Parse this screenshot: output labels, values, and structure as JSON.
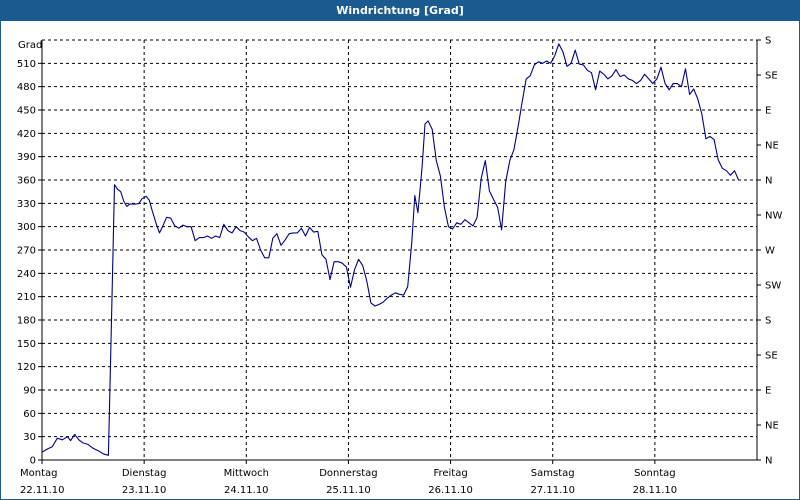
{
  "window": {
    "title": "Windrichtung [Grad]"
  },
  "chart_data": {
    "type": "line",
    "title": "Windrichtung [Grad]",
    "ylabel": "Grad",
    "ylim": [
      0,
      540
    ],
    "yticks": [
      0,
      30,
      60,
      90,
      120,
      150,
      180,
      210,
      240,
      270,
      300,
      330,
      360,
      390,
      420,
      450,
      480,
      510
    ],
    "ytick_labels_right": [
      "N",
      "NE",
      "E",
      "SE",
      "S",
      "SW",
      "W",
      "NW",
      "N",
      "NE",
      "E",
      "SE",
      "S"
    ],
    "xlim": [
      0,
      7
    ],
    "x_unit": "days",
    "x_ticks": [
      {
        "x": 0,
        "day": "Montag",
        "date": "22.11.10"
      },
      {
        "x": 1,
        "day": "Dienstag",
        "date": "23.11.10"
      },
      {
        "x": 2,
        "day": "Mittwoch",
        "date": "24.11.10"
      },
      {
        "x": 3,
        "day": "Donnerstag",
        "date": "25.11.10"
      },
      {
        "x": 4,
        "day": "Freitag",
        "date": "26.11.10"
      },
      {
        "x": 5,
        "day": "Samstag",
        "date": "27.11.10"
      },
      {
        "x": 6,
        "day": "Sonntag",
        "date": "28.11.10"
      }
    ],
    "grid": true,
    "line_color": "#00008b",
    "series": [
      {
        "points": [
          [
            0.0,
            10
          ],
          [
            0.05,
            14
          ],
          [
            0.1,
            17
          ],
          [
            0.15,
            28
          ],
          [
            0.2,
            26
          ],
          [
            0.25,
            30
          ],
          [
            0.28,
            25
          ],
          [
            0.32,
            33
          ],
          [
            0.36,
            26
          ],
          [
            0.4,
            22
          ],
          [
            0.45,
            20
          ],
          [
            0.5,
            15
          ],
          [
            0.55,
            12
          ],
          [
            0.6,
            8
          ],
          [
            0.65,
            6
          ],
          [
            0.68,
            180
          ],
          [
            0.71,
            354
          ],
          [
            0.74,
            348
          ],
          [
            0.77,
            345
          ],
          [
            0.8,
            333
          ],
          [
            0.83,
            326
          ],
          [
            0.86,
            329
          ],
          [
            0.89,
            329
          ],
          [
            0.92,
            329
          ],
          [
            0.95,
            330
          ],
          [
            0.98,
            336
          ],
          [
            1.02,
            339
          ],
          [
            1.05,
            334
          ],
          [
            1.08,
            320
          ],
          [
            1.12,
            303
          ],
          [
            1.15,
            292
          ],
          [
            1.18,
            300
          ],
          [
            1.22,
            312
          ],
          [
            1.26,
            311
          ],
          [
            1.3,
            301
          ],
          [
            1.34,
            298
          ],
          [
            1.38,
            302
          ],
          [
            1.42,
            300
          ],
          [
            1.46,
            300
          ],
          [
            1.5,
            282
          ],
          [
            1.54,
            286
          ],
          [
            1.58,
            286
          ],
          [
            1.62,
            288
          ],
          [
            1.66,
            285
          ],
          [
            1.7,
            288
          ],
          [
            1.74,
            286
          ],
          [
            1.78,
            303
          ],
          [
            1.82,
            295
          ],
          [
            1.86,
            292
          ],
          [
            1.9,
            300
          ],
          [
            1.94,
            295
          ],
          [
            1.98,
            293
          ],
          [
            2.02,
            287
          ],
          [
            2.06,
            282
          ],
          [
            2.1,
            285
          ],
          [
            2.14,
            270
          ],
          [
            2.18,
            260
          ],
          [
            2.22,
            260
          ],
          [
            2.26,
            285
          ],
          [
            2.3,
            291
          ],
          [
            2.34,
            276
          ],
          [
            2.38,
            283
          ],
          [
            2.42,
            291
          ],
          [
            2.46,
            292
          ],
          [
            2.5,
            292
          ],
          [
            2.54,
            298
          ],
          [
            2.58,
            288
          ],
          [
            2.62,
            299
          ],
          [
            2.66,
            293
          ],
          [
            2.7,
            294
          ],
          [
            2.74,
            264
          ],
          [
            2.78,
            258
          ],
          [
            2.82,
            232
          ],
          [
            2.86,
            255
          ],
          [
            2.9,
            255
          ],
          [
            2.94,
            253
          ],
          [
            2.98,
            248
          ],
          [
            3.02,
            222
          ],
          [
            3.06,
            245
          ],
          [
            3.1,
            258
          ],
          [
            3.14,
            250
          ],
          [
            3.18,
            230
          ],
          [
            3.22,
            202
          ],
          [
            3.26,
            198
          ],
          [
            3.3,
            200
          ],
          [
            3.34,
            203
          ],
          [
            3.38,
            208
          ],
          [
            3.42,
            212
          ],
          [
            3.46,
            215
          ],
          [
            3.5,
            213
          ],
          [
            3.54,
            212
          ],
          [
            3.58,
            223
          ],
          [
            3.62,
            280
          ],
          [
            3.65,
            340
          ],
          [
            3.68,
            318
          ],
          [
            3.72,
            375
          ],
          [
            3.75,
            432
          ],
          [
            3.78,
            436
          ],
          [
            3.82,
            425
          ],
          [
            3.86,
            385
          ],
          [
            3.9,
            365
          ],
          [
            3.94,
            325
          ],
          [
            3.98,
            300
          ],
          [
            4.02,
            297
          ],
          [
            4.06,
            305
          ],
          [
            4.1,
            303
          ],
          [
            4.14,
            309
          ],
          [
            4.18,
            305
          ],
          [
            4.22,
            301
          ],
          [
            4.26,
            312
          ],
          [
            4.3,
            362
          ],
          [
            4.34,
            385
          ],
          [
            4.38,
            346
          ],
          [
            4.42,
            335
          ],
          [
            4.46,
            325
          ],
          [
            4.5,
            296
          ],
          [
            4.54,
            358
          ],
          [
            4.58,
            385
          ],
          [
            4.62,
            399
          ],
          [
            4.66,
            428
          ],
          [
            4.7,
            460
          ],
          [
            4.74,
            490
          ],
          [
            4.78,
            494
          ],
          [
            4.82,
            508
          ],
          [
            4.86,
            512
          ],
          [
            4.9,
            510
          ],
          [
            4.94,
            513
          ],
          [
            4.98,
            510
          ],
          [
            5.02,
            520
          ],
          [
            5.06,
            535
          ],
          [
            5.1,
            525
          ],
          [
            5.14,
            506
          ],
          [
            5.18,
            510
          ],
          [
            5.22,
            527
          ],
          [
            5.26,
            509
          ],
          [
            5.3,
            508
          ],
          [
            5.34,
            501
          ],
          [
            5.38,
            498
          ],
          [
            5.42,
            476
          ],
          [
            5.46,
            500
          ],
          [
            5.5,
            496
          ],
          [
            5.54,
            490
          ],
          [
            5.58,
            494
          ],
          [
            5.62,
            502
          ],
          [
            5.66,
            493
          ],
          [
            5.7,
            495
          ],
          [
            5.74,
            490
          ],
          [
            5.78,
            488
          ],
          [
            5.82,
            484
          ],
          [
            5.86,
            488
          ],
          [
            5.9,
            496
          ],
          [
            5.94,
            490
          ],
          [
            5.98,
            484
          ],
          [
            6.02,
            490
          ],
          [
            6.06,
            505
          ],
          [
            6.1,
            484
          ],
          [
            6.14,
            476
          ],
          [
            6.18,
            484
          ],
          [
            6.22,
            484
          ],
          [
            6.26,
            480
          ],
          [
            6.3,
            503
          ],
          [
            6.34,
            470
          ],
          [
            6.38,
            477
          ],
          [
            6.42,
            464
          ],
          [
            6.46,
            445
          ],
          [
            6.5,
            413
          ],
          [
            6.54,
            416
          ],
          [
            6.58,
            412
          ],
          [
            6.62,
            386
          ],
          [
            6.66,
            375
          ],
          [
            6.7,
            372
          ],
          [
            6.74,
            366
          ],
          [
            6.78,
            372
          ],
          [
            6.82,
            360
          ]
        ]
      }
    ]
  }
}
